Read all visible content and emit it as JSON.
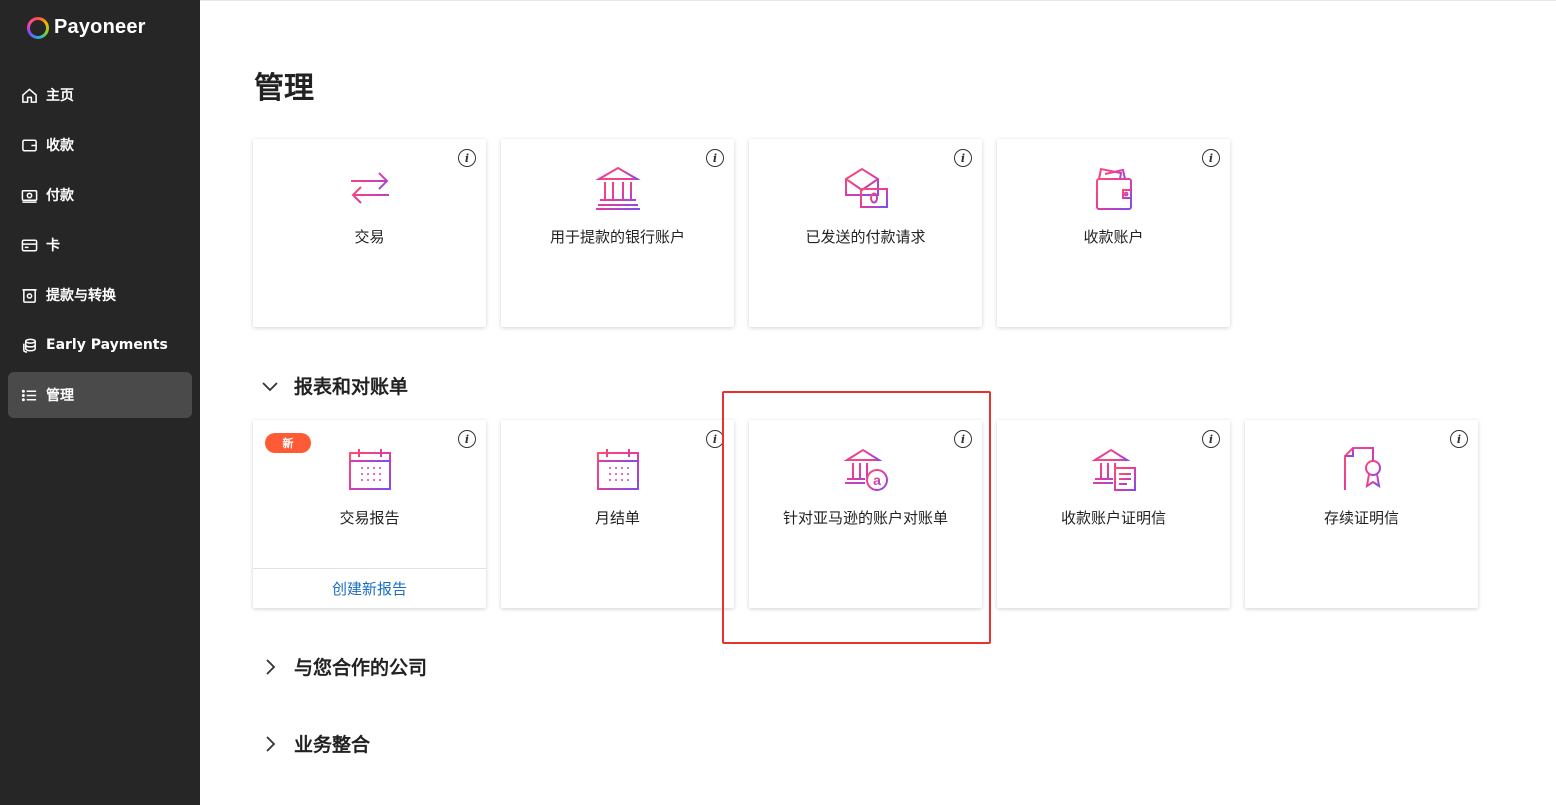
{
  "brand": {
    "name": "Payoneer"
  },
  "sidebar": {
    "items": [
      {
        "label": "主页",
        "icon": "home-icon",
        "active": false
      },
      {
        "label": "收款",
        "icon": "wallet-icon",
        "active": false
      },
      {
        "label": "付款",
        "icon": "payment-icon",
        "active": false
      },
      {
        "label": "卡",
        "icon": "card-icon",
        "active": false
      },
      {
        "label": "提款与转换",
        "icon": "withdraw-icon",
        "active": false
      },
      {
        "label": "Early Payments",
        "icon": "coins-icon",
        "active": false
      },
      {
        "label": "管理",
        "icon": "list-icon",
        "active": true
      }
    ]
  },
  "page": {
    "title": "管理"
  },
  "manage_cards": [
    {
      "label": "交易",
      "icon": "transfer-arrows-icon"
    },
    {
      "label": "用于提款的银行账户",
      "icon": "bank-icon"
    },
    {
      "label": "已发送的付款请求",
      "icon": "payment-request-icon"
    },
    {
      "label": "收款账户",
      "icon": "wallet-icon"
    }
  ],
  "reports_section": {
    "title": "报表和对账单",
    "expanded": true,
    "cards": [
      {
        "label": "交易报告",
        "icon": "calendar-icon",
        "badge": "新",
        "footer": "创建新报告"
      },
      {
        "label": "月结单",
        "icon": "calendar-icon"
      },
      {
        "label": "针对亚马逊的账户对账单",
        "icon": "bank-amazon-icon"
      },
      {
        "label": "收款账户证明信",
        "icon": "bank-document-icon"
      },
      {
        "label": "存续证明信",
        "icon": "certificate-icon"
      }
    ]
  },
  "partners_section": {
    "title": "与您合作的公司",
    "expanded": false
  },
  "integrations_section": {
    "title": "业务整合",
    "expanded": false
  },
  "info_glyph": "i",
  "colors": {
    "sidebar_bg": "#262626",
    "active_bg": "#4a4a4a",
    "accent_pink": "#e8388a",
    "accent_purple": "#8a4cf0",
    "link": "#1a6fc4",
    "badge": "#ff5a36",
    "highlight": "#e8322c"
  }
}
